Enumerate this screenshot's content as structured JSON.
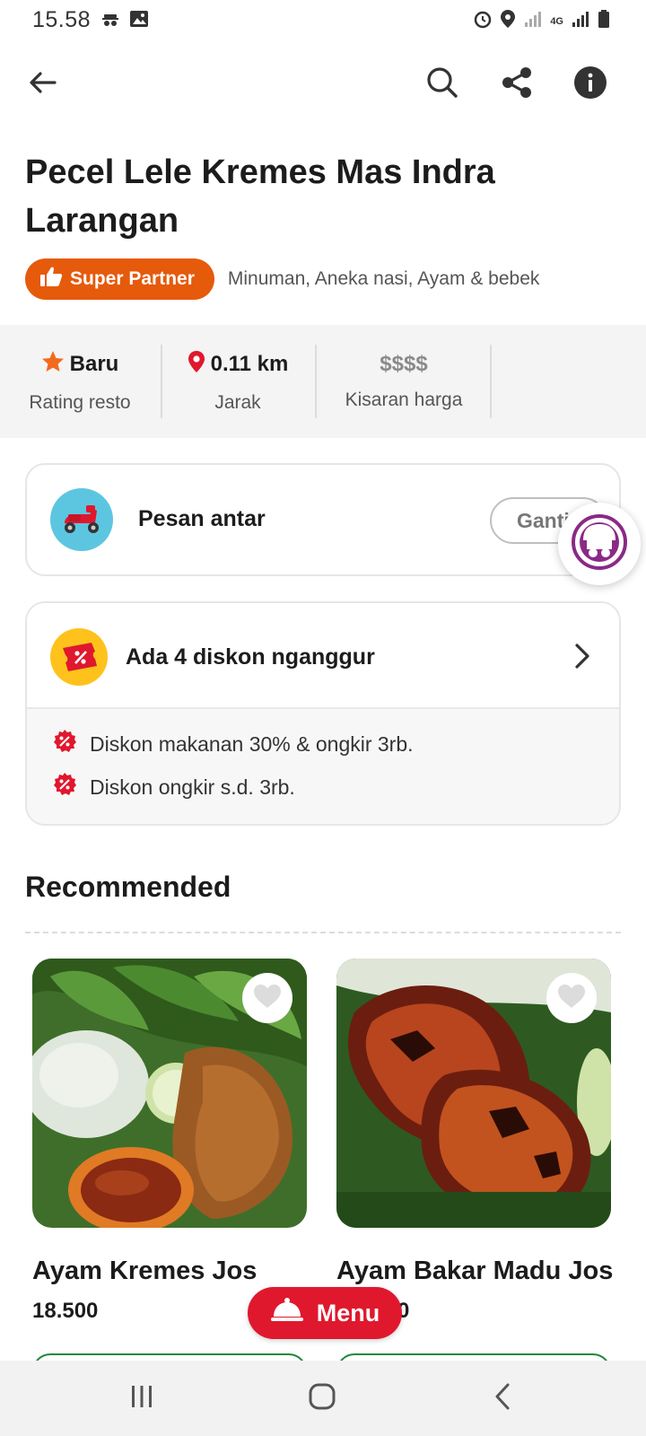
{
  "status_bar": {
    "time": "15.58",
    "network": "4G"
  },
  "restaurant": {
    "name": "Pecel Lele Kremes Mas Indra Larangan",
    "badge": "Super Partner",
    "categories": "Minuman, Aneka nasi, Ayam & bebek"
  },
  "info": {
    "rating_value": "Baru",
    "rating_label": "Rating resto",
    "distance_value": "0.11 km",
    "distance_label": "Jarak",
    "price_value": "$$$$",
    "price_label": "Kisaran harga"
  },
  "delivery": {
    "label": "Pesan antar",
    "change_label": "Ganti"
  },
  "discounts": {
    "title": "Ada 4 diskon nganggur",
    "items": [
      "Diskon makanan 30% & ongkir 3rb.",
      "Diskon ongkir s.d. 3rb."
    ]
  },
  "recommended": {
    "title": "Recommended",
    "products": [
      {
        "name": "Ayam Kremes Jos",
        "price": "18.500"
      },
      {
        "name": "Ayam Bakar Madu Jos",
        "price": "0"
      }
    ]
  },
  "menu_button": "Menu",
  "colors": {
    "brand_orange": "#e65a0c",
    "brand_red": "#e0182e",
    "location_red": "#e0182e",
    "star_orange": "#f26b1d",
    "discount_red": "#e0182e",
    "delivery_blue": "#5cc6e0",
    "green_outline": "#1c8a3c"
  },
  "icons": {
    "back": "arrow-left-icon",
    "search": "search-icon",
    "share": "share-icon",
    "info": "info-icon",
    "star": "star-icon",
    "location": "location-pin-icon",
    "scooter": "scooter-icon",
    "discount": "discount-coupon-icon",
    "chevron": "chevron-right-icon",
    "heart": "heart-icon",
    "cloche": "cloche-icon"
  }
}
